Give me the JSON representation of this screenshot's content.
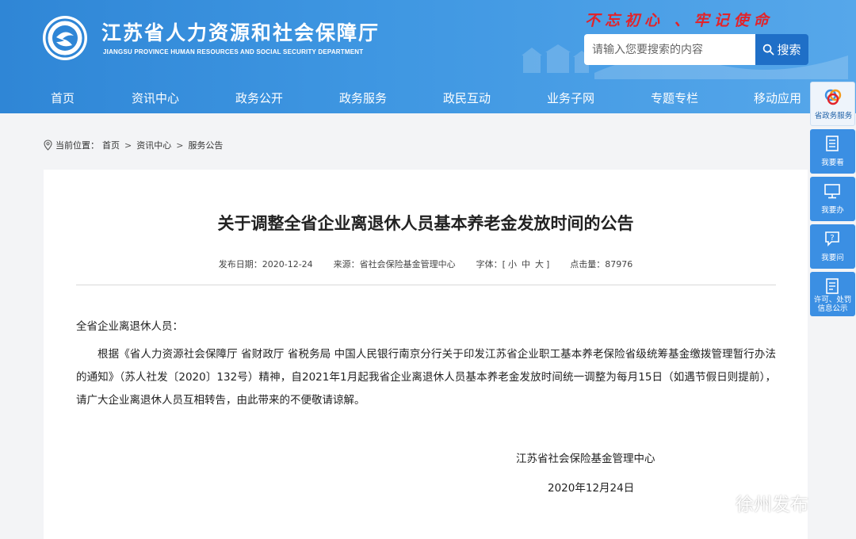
{
  "header": {
    "title_cn": "江苏省人力资源和社会保障厅",
    "title_en": "JIANGSU PROVINCE HUMAN RESOURCES AND SOCIAL SECURITY DEPARTMENT",
    "slogan": "不忘初心 、牢记使命",
    "search_placeholder": "请输入您要搜索的内容",
    "search_button": "搜索",
    "colors": {
      "header_blue": "#3f97e2",
      "slogan_red": "#e2232a",
      "search_button": "#1f6fc7"
    }
  },
  "nav": [
    {
      "label": "首页"
    },
    {
      "label": "资讯中心"
    },
    {
      "label": "政务公开"
    },
    {
      "label": "政务服务"
    },
    {
      "label": "政民互动"
    },
    {
      "label": "业务子网"
    },
    {
      "label": "专题专栏"
    },
    {
      "label": "移动应用"
    }
  ],
  "breadcrumb": {
    "prefix": "当前位置：",
    "items": [
      "首页",
      "资讯中心",
      "服务公告"
    ],
    "separator": ">",
    "icon": "location-pin-icon"
  },
  "article": {
    "title": "关于调整全省企业离退休人员基本养老金发放时间的公告",
    "meta": {
      "date_label": "发布日期：",
      "date": "2020-12-24",
      "source_label": "来源：",
      "source": "省社会保险基金管理中心",
      "font_label": "字体：[",
      "font_small": "小",
      "font_medium": "中",
      "font_large": "大",
      "font_close": "]",
      "clicks_label": "点击量：",
      "clicks": "87976"
    },
    "salutation": "全省企业离退休人员：",
    "body": "根据《省人力资源社会保障厅 省财政厅 省税务局 中国人民银行南京分行关于印发江苏省企业职工基本养老保险省级统筹基金缴拨管理暂行办法的通知》（苏人社发〔2020〕132号）精神，自2021年1月起我省企业离退休人员基本养老金发放时间统一调整为每月15日（如遇节假日则提前），请广大企业离退休人员互相转告，由此带来的不便敬请谅解。",
    "signer": "江苏省社会保险基金管理中心",
    "sign_date": "2020年12月24日"
  },
  "sidebar": [
    {
      "label": "省政务服务",
      "icon": "gov-service-logo-icon"
    },
    {
      "label": "我要看",
      "icon": "document-list-icon"
    },
    {
      "label": "我要办",
      "icon": "monitor-icon"
    },
    {
      "label": "我要问",
      "icon": "question-bubble-icon"
    },
    {
      "label": "许可、处罚\n信息公示",
      "icon": "info-list-icon"
    }
  ],
  "watermark": {
    "text": "徐州发布",
    "icon": "wechat-icon"
  }
}
